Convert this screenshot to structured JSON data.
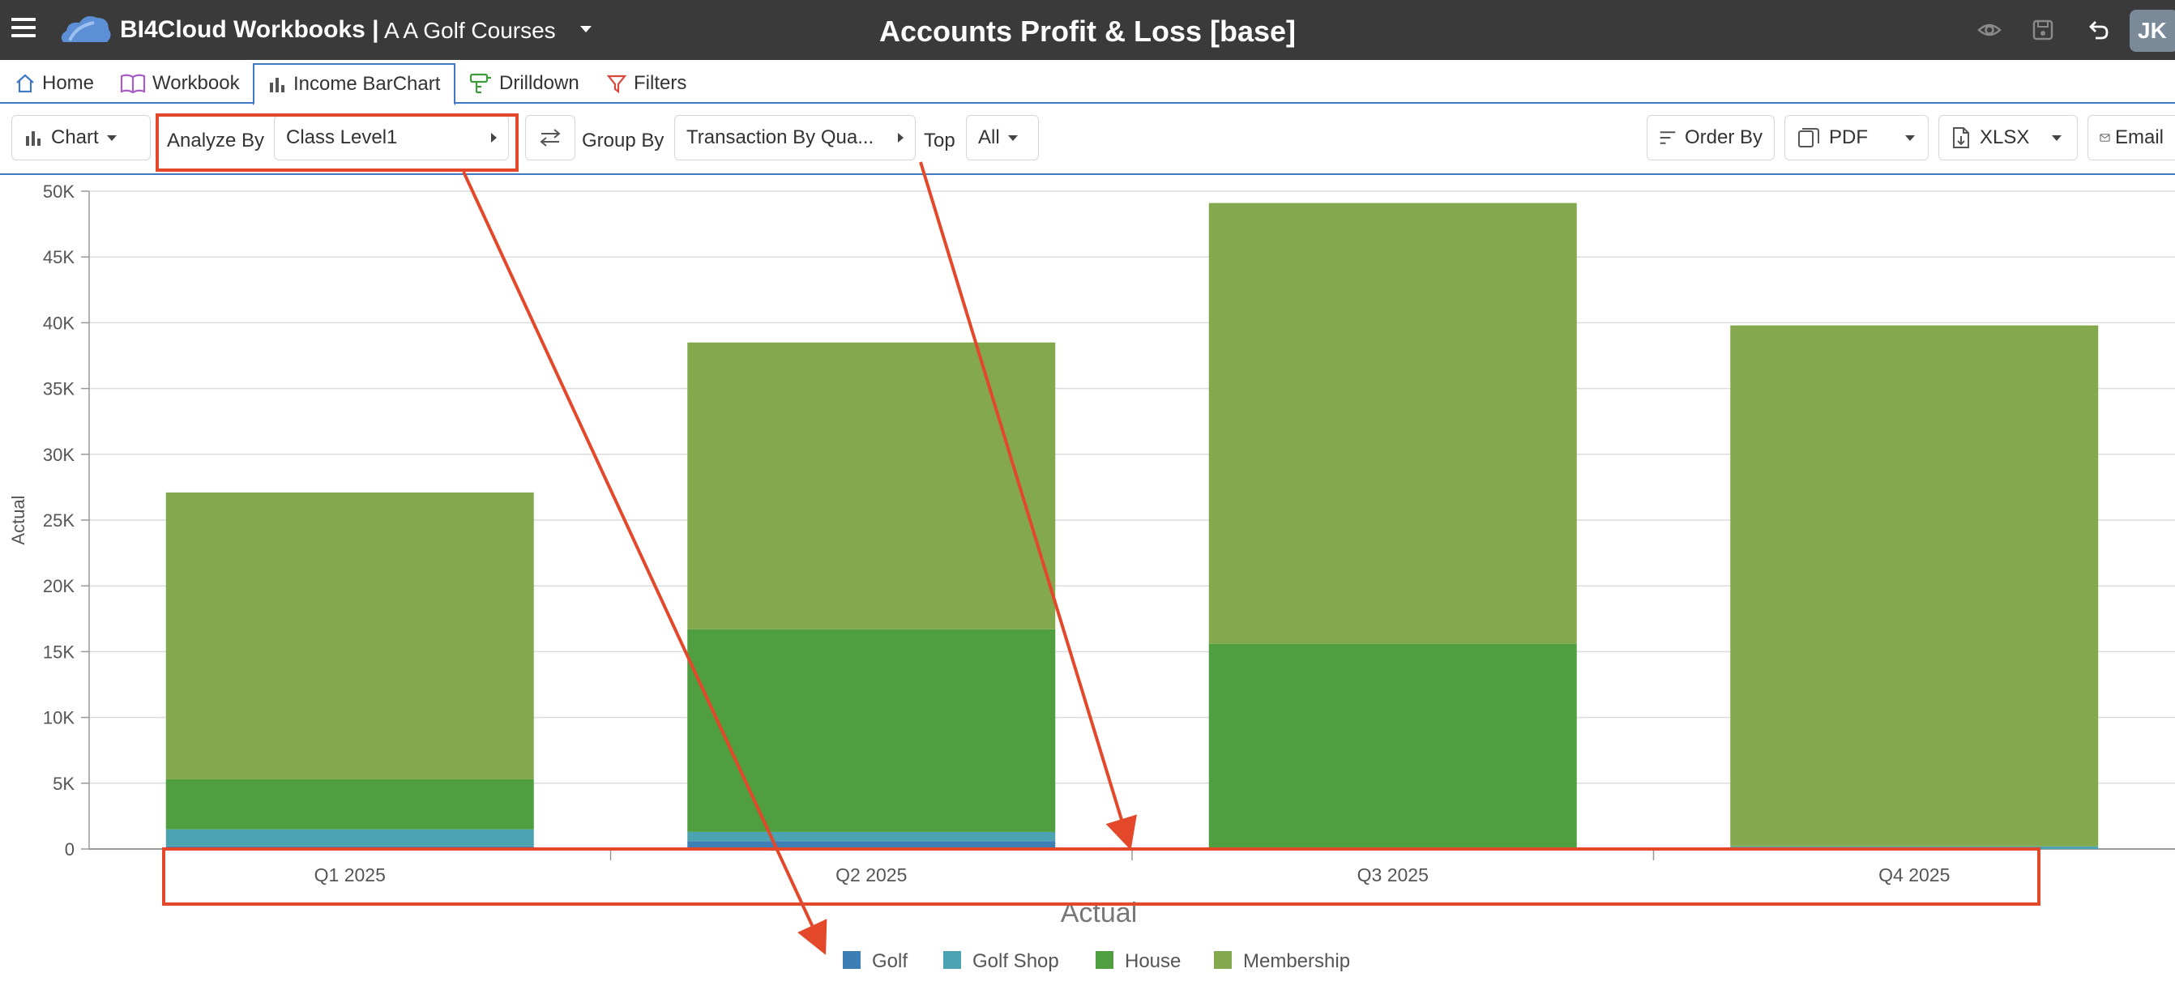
{
  "header": {
    "brand": "BI4Cloud Workbooks",
    "separator": "|",
    "company": "A A Golf Courses",
    "title": "Accounts Profit & Loss [base]",
    "avatar_initials": "JK"
  },
  "tabs": [
    {
      "label": "Home",
      "icon": "home-icon",
      "active": false
    },
    {
      "label": "Workbook",
      "icon": "book-icon",
      "active": false
    },
    {
      "label": "Income BarChart",
      "icon": "bar-chart-icon",
      "active": true
    },
    {
      "label": "Drilldown",
      "icon": "drilldown-icon",
      "active": false
    },
    {
      "label": "Filters",
      "icon": "filter-icon",
      "active": false
    }
  ],
  "toolbar": {
    "chart_label": "Chart",
    "analyze_by_label": "Analyze By",
    "analyze_by_value": "Class Level1",
    "group_by_label": "Group By",
    "group_by_value": "Transaction By Qua...",
    "top_label": "Top",
    "top_value": "All",
    "order_by_label": "Order By",
    "pdf_label": "PDF",
    "xlsx_label": "XLSX",
    "email_label": "Email"
  },
  "colors": {
    "titlebar": "#3a3a3a",
    "accent": "#3f78c4",
    "annotation": "#e3482b"
  },
  "chart_data": {
    "type": "bar",
    "stacked": true,
    "categories": [
      "Q1 2025",
      "Q2 2025",
      "Q3 2025",
      "Q4 2025"
    ],
    "series": [
      {
        "name": "Golf",
        "color": "#3d7eb5",
        "values": [
          200,
          600,
          0,
          0
        ]
      },
      {
        "name": "Golf Shop",
        "color": "#4ba3b2",
        "values": [
          1300,
          700,
          0,
          200
        ]
      },
      {
        "name": "House",
        "color": "#4f9e3f",
        "values": [
          3800,
          15400,
          15600,
          0
        ]
      },
      {
        "name": "Membership",
        "color": "#84a84e",
        "values": [
          21800,
          21800,
          33500,
          39600
        ]
      }
    ],
    "ylabel": "Actual",
    "xlabel": "Actual",
    "ylim": [
      0,
      50000
    ],
    "yticks": [
      "0",
      "5K",
      "10K",
      "15K",
      "20K",
      "25K",
      "30K",
      "35K",
      "40K",
      "45K",
      "50K"
    ],
    "grid": true,
    "legend_position": "bottom"
  }
}
